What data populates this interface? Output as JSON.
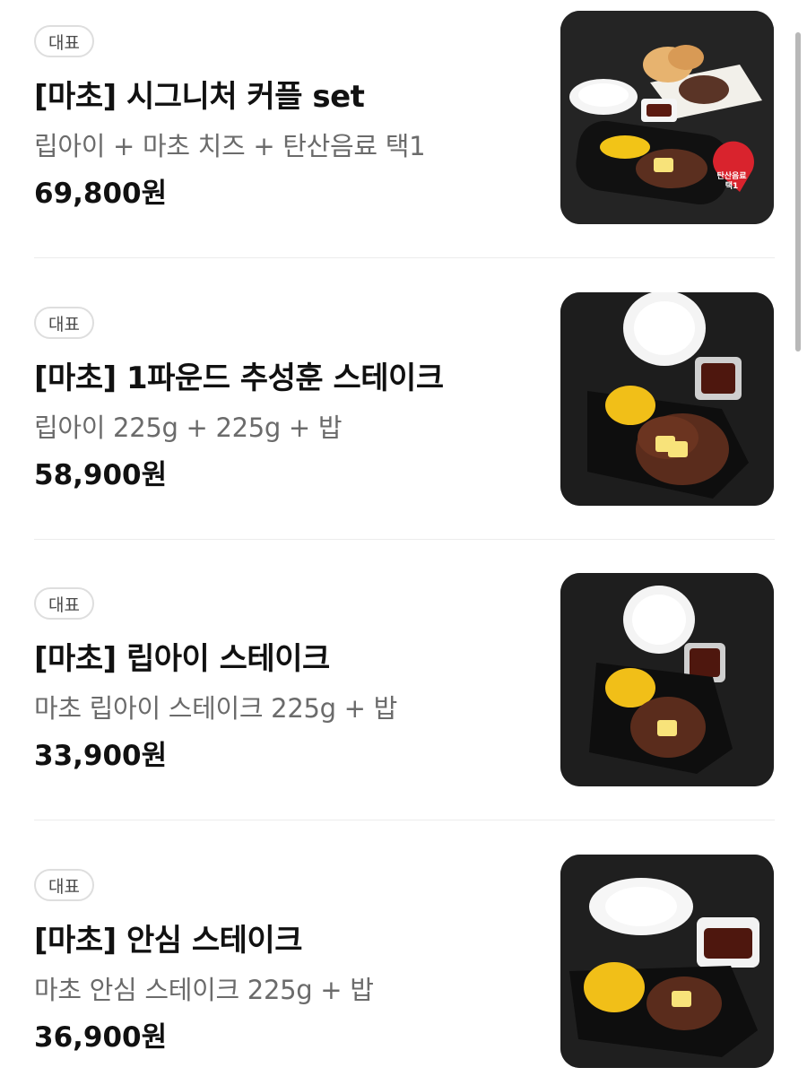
{
  "menu": {
    "items": [
      {
        "badge": "대표",
        "title": "[마초] 시그니처 커플 set",
        "description": "립아이 + 마초 치즈 + 탄산음료 택1",
        "price": "69,800원",
        "image_sticker": "탄산음료 택1"
      },
      {
        "badge": "대표",
        "title": "[마초] 1파운드 추성훈 스테이크",
        "description": "립아이 225g + 225g + 밥",
        "price": "58,900원"
      },
      {
        "badge": "대표",
        "title": "[마초] 립아이 스테이크",
        "description": "마초 립아이 스테이크 225g + 밥",
        "price": "33,900원"
      },
      {
        "badge": "대표",
        "title": "[마초] 안심 스테이크",
        "description": "마초 안심 스테이크 225g + 밥",
        "price": "36,900원"
      }
    ]
  },
  "colors": {
    "background": "#ffffff",
    "text_primary": "#111111",
    "text_secondary": "#6b6b6b",
    "badge_border": "#dedede",
    "divider": "#ececec",
    "sticker_red": "#d9232d",
    "photo_background": "#1e1e1e"
  },
  "icons": {
    "scrollbar": "vertical-scrollbar-thumb"
  }
}
